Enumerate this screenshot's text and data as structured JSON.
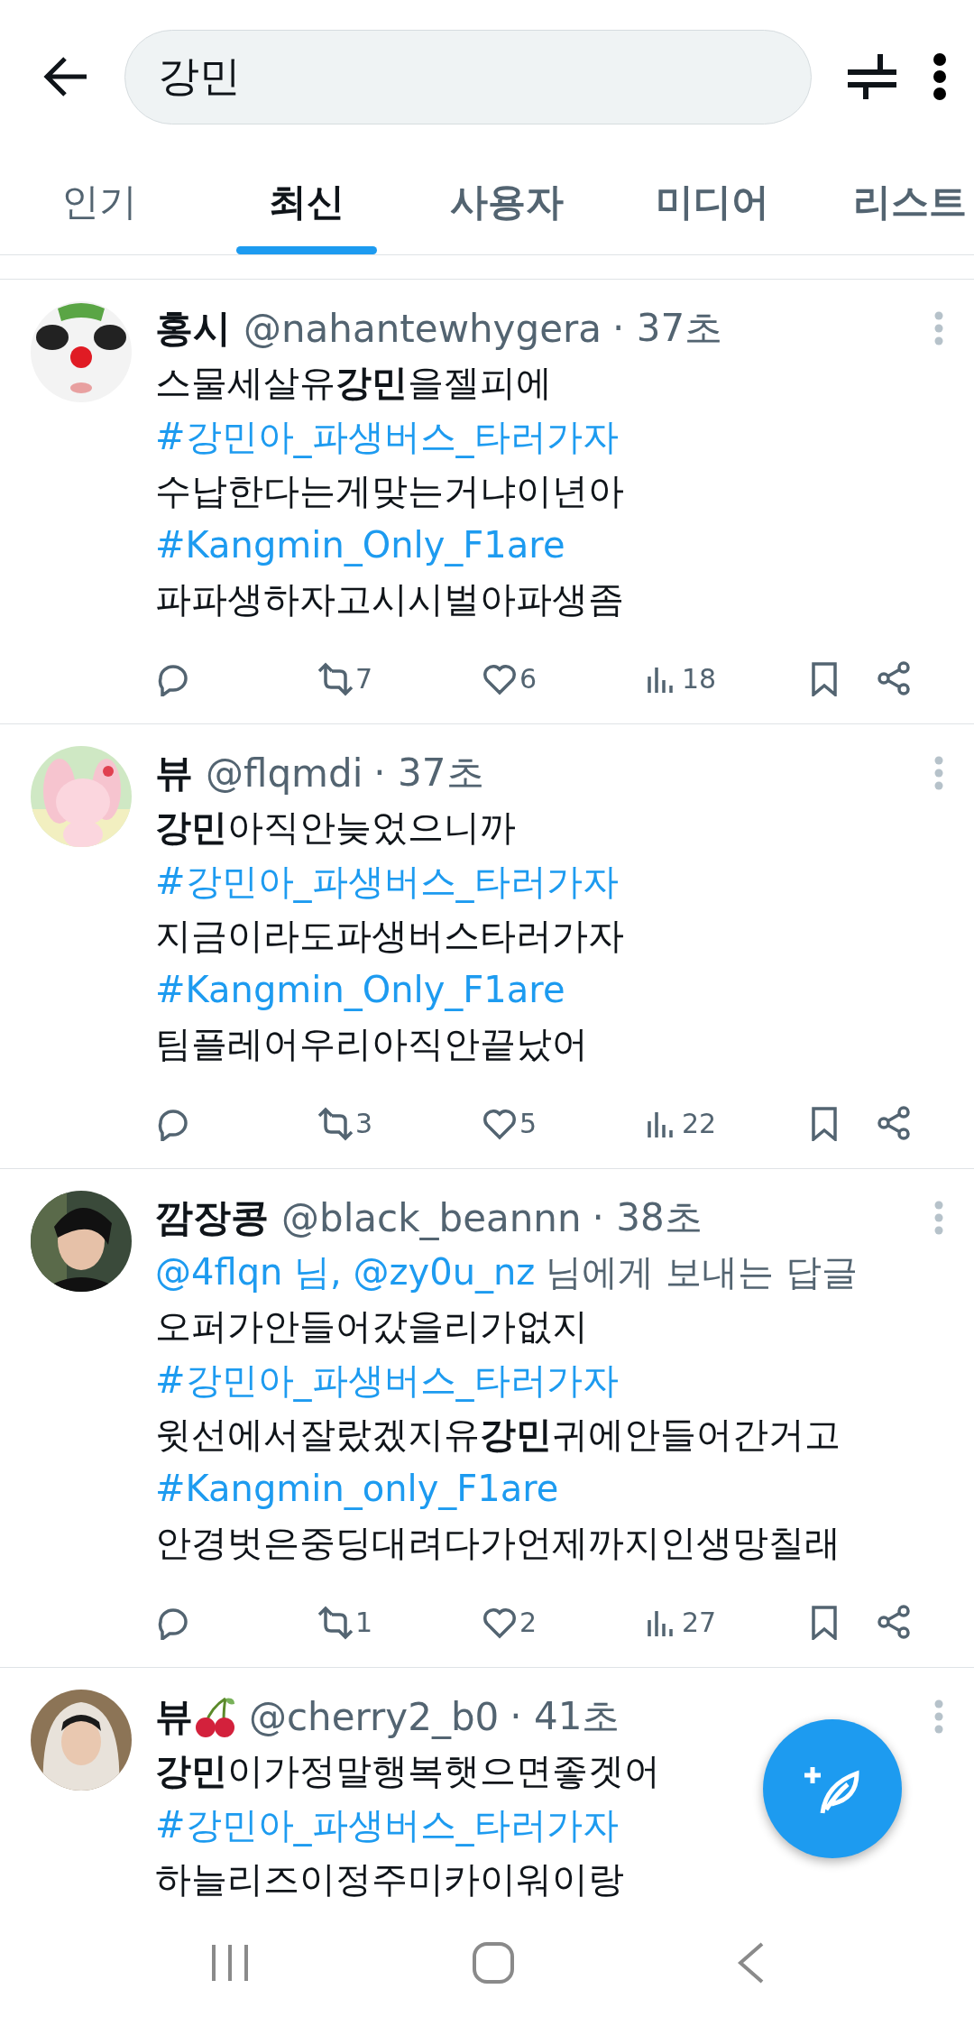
{
  "search": {
    "value": "강민"
  },
  "tabs": [
    {
      "label": "인기",
      "selected": false
    },
    {
      "label": "최신",
      "selected": true
    },
    {
      "label": "사용자",
      "selected": false
    },
    {
      "label": "미디어",
      "selected": false
    },
    {
      "label": "리스트",
      "selected": false
    }
  ],
  "tweets": [
    {
      "name": "홍시",
      "handle": "@nahantewhygera",
      "time": "· 37초",
      "lines": [
        {
          "kind": "text",
          "text": "스물세살유**강민**을젤피에"
        },
        {
          "kind": "hashtag",
          "text": "#강민아_파생버스_타러가자"
        },
        {
          "kind": "text",
          "text": "수납한다는게맞는거냐이년아"
        },
        {
          "kind": "hashtag",
          "text": "#Kangmin_Only_F1are"
        },
        {
          "kind": "text",
          "text": "파파생하자고시시벌아파생좀"
        }
      ],
      "retweets": "7",
      "likes": "6",
      "views": "18"
    },
    {
      "name": "뷰",
      "handle": "@flqmdi",
      "time": "· 37초",
      "lines": [
        {
          "kind": "text",
          "text": "**강민**아직안늦었으니까"
        },
        {
          "kind": "hashtag",
          "text": "#강민아_파생버스_타러가자"
        },
        {
          "kind": "text",
          "text": "지금이라도파생버스타러가자"
        },
        {
          "kind": "hashtag",
          "text": "#Kangmin_Only_F1are"
        },
        {
          "kind": "text",
          "text": "팀플레어우리아직안끝났어"
        }
      ],
      "retweets": "3",
      "likes": "5",
      "views": "22"
    },
    {
      "name": "깜장콩",
      "handle": "@black_beannn",
      "time": "· 38초",
      "lines": [
        {
          "kind": "reply",
          "mentions": "@4flqn 님, @zy0u_nz",
          "text": "님에게 보내는 답글"
        },
        {
          "kind": "text",
          "text": "오퍼가안들어갔을리가없지"
        },
        {
          "kind": "hashtag",
          "text": "#강민아_파생버스_타러가자"
        },
        {
          "kind": "text",
          "text": "윗선에서잘랐겠지유**강민**귀에안들어간거고"
        },
        {
          "kind": "hashtag",
          "text": "#Kangmin_only_F1are"
        },
        {
          "kind": "text",
          "text": "안경벗은중딩대려다가언제까지인생망칠래"
        }
      ],
      "retweets": "1",
      "likes": "2",
      "views": "27"
    },
    {
      "name": "뷰",
      "has_emoji": true,
      "handle": "@cherry2_b0",
      "time": "· 41초",
      "lines": [
        {
          "kind": "text",
          "text": "**강민**이가정말행복햇으면좋겟어"
        },
        {
          "kind": "hashtag",
          "text": "#강민아_파생버스_타러가자"
        },
        {
          "kind": "text",
          "text": "하늘리즈이정주미카이워이랑"
        }
      ]
    }
  ]
}
